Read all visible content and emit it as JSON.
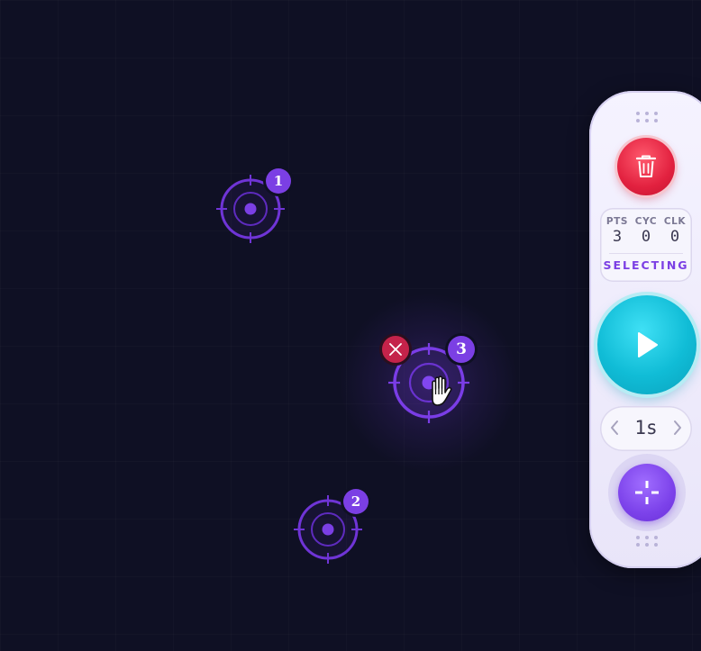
{
  "targets": [
    {
      "badge": "1"
    },
    {
      "badge": "2"
    },
    {
      "badge": "3"
    }
  ],
  "panel": {
    "stats": {
      "pts_label": "PTS",
      "pts_value": "3",
      "cyc_label": "CYC",
      "cyc_value": "0",
      "clk_label": "CLK",
      "clk_value": "0",
      "status": "SELECTING"
    },
    "interval": {
      "value": "1s"
    }
  },
  "icons": {
    "clear": "trash-icon",
    "start": "play-icon",
    "add": "crosshair-icon",
    "remove": "close-icon",
    "cursor": "hand-cursor-icon"
  },
  "colors": {
    "background": "#0f1024",
    "accent": "#7b3fe4",
    "danger": "#e2213f",
    "start": "#10bcd6"
  }
}
